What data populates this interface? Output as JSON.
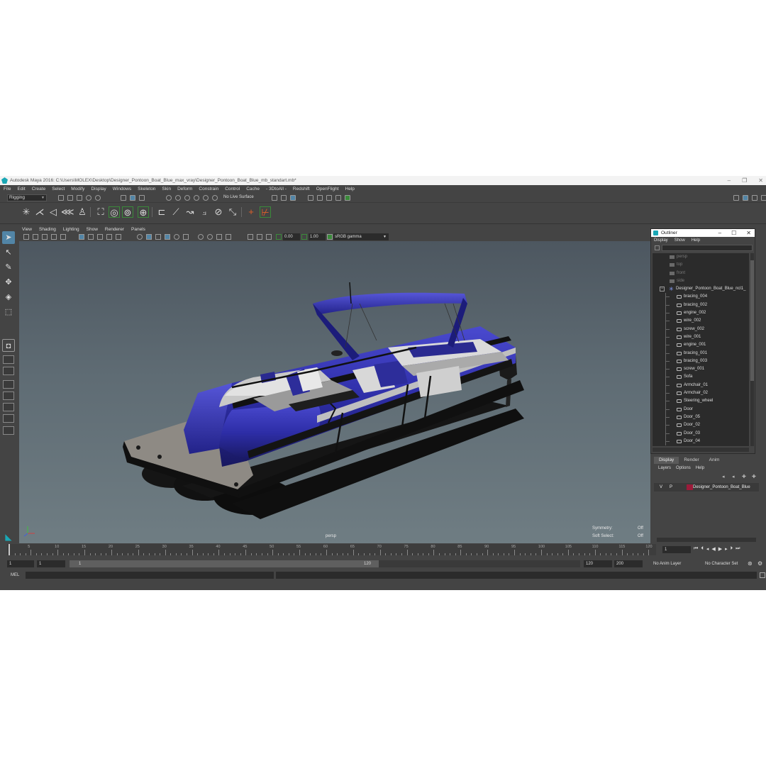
{
  "window": {
    "title": "Autodesk Maya 2016: C:\\Users\\MOLEX\\Desktop\\Designer_Pontoon_Boat_Blue_max_vray\\Designer_Pontoon_Boat_Blue_mb_standart.mb*"
  },
  "menubar": [
    "File",
    "Edit",
    "Create",
    "Select",
    "Modify",
    "Display",
    "Windows",
    "Skeleton",
    "Skin",
    "Deform",
    "Constrain",
    "Control",
    "Cache",
    "- 3DtoAll -",
    "Redshift",
    "OpenFlight",
    "Help"
  ],
  "status": {
    "mode": "Rigging",
    "live_surface": "No Live Surface"
  },
  "viewport": {
    "menu": [
      "View",
      "Shading",
      "Lighting",
      "Show",
      "Renderer",
      "Panels"
    ],
    "exposure": "0.00",
    "gamma": "1.00",
    "colorspace": "sRGB gamma",
    "camera_label": "persp",
    "symmetry_label": "Symmetry:",
    "symmetry_value": "Off",
    "soft_select_label": "Soft Select:",
    "soft_select_value": "Off",
    "hull_color": "#2e2ea8",
    "deck_color": "#8e8a84"
  },
  "outliner": {
    "title": "Outliner",
    "menu": [
      "Display",
      "Show",
      "Help"
    ],
    "cameras": [
      "persp",
      "top",
      "front",
      "side"
    ],
    "root": "Designer_Pontoon_Boat_Blue_ncl1_",
    "children": [
      "bracing_004",
      "bracing_002",
      "engine_002",
      "wire_002",
      "screw_002",
      "wire_001",
      "engine_001",
      "bracing_001",
      "bracing_003",
      "screw_001",
      "Sofa",
      "Armchair_01",
      "Armchair_02",
      "Steering_wheel",
      "Door",
      "Door_05",
      "Door_02",
      "Door_03",
      "Door_04"
    ]
  },
  "layers": {
    "tabs": [
      "Display",
      "Render",
      "Anim"
    ],
    "menu": [
      "Layers",
      "Options",
      "Help"
    ],
    "row": {
      "v": "V",
      "p": "P",
      "name": "Designer_Pontoon_Boat_Blue"
    }
  },
  "timeline": {
    "tick_labels": [
      "5",
      "10",
      "15",
      "20",
      "25",
      "30",
      "35",
      "40",
      "45",
      "50",
      "55",
      "60",
      "65",
      "70",
      "75",
      "80",
      "85",
      "90",
      "95",
      "100",
      "105",
      "110",
      "115",
      "120"
    ],
    "current_frame": "1",
    "range_start": "1",
    "playback_start": "1",
    "range_bar_start": "1",
    "range_bar_end": "120",
    "playback_end": "120",
    "range_end": "200",
    "anim_layer": "No Anim Layer",
    "character_set": "No Character Set"
  },
  "cmdline": {
    "label": "MEL"
  }
}
